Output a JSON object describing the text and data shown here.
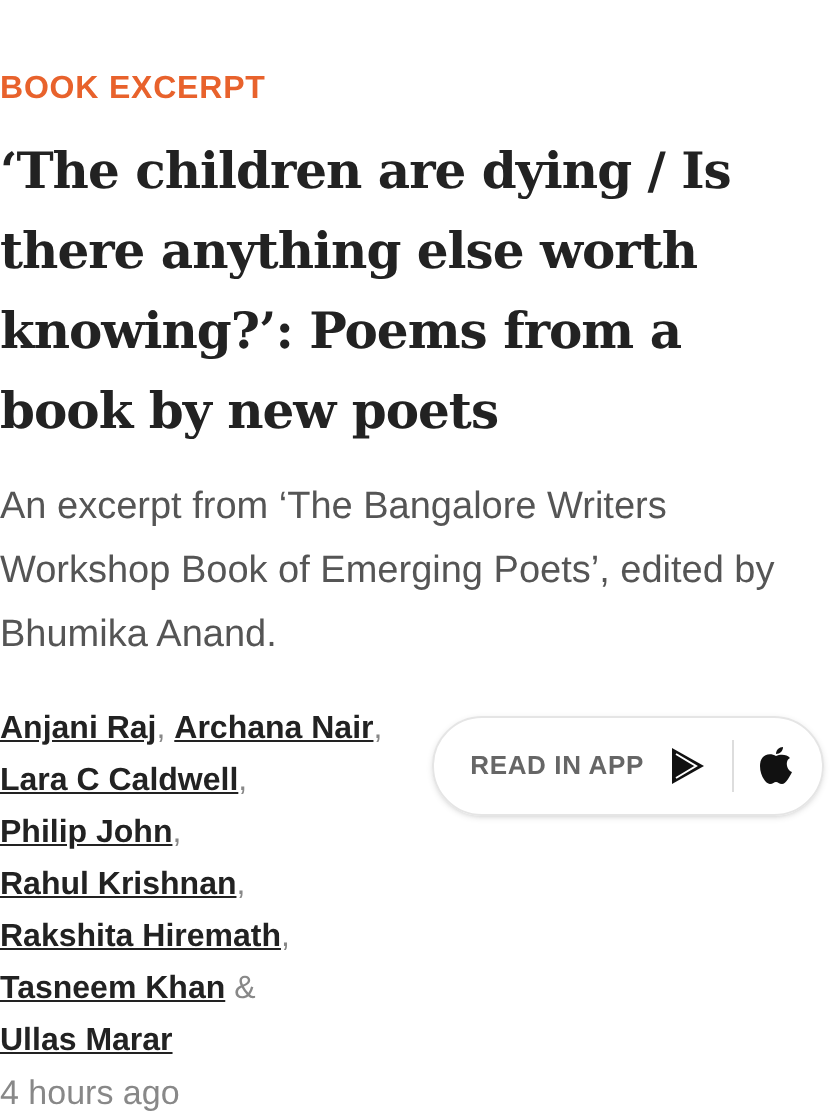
{
  "section_label": "BOOK EXCERPT",
  "headline": "‘The children are dying / Is there anything else worth knowing?’: Poems from a book by new poets",
  "standfirst": "An excerpt from ‘The Bangalore Writers Workshop Book of Emerging Poets’, edited by Bhumika Anand.",
  "authors": [
    {
      "name": "Anjani Raj",
      "separator": ","
    },
    {
      "name": "Archana Nair",
      "separator": ","
    },
    {
      "name": "Lara C Caldwell",
      "separator": ","
    },
    {
      "name": "Philip John",
      "separator": ","
    },
    {
      "name": "Rahul Krishnan",
      "separator": ","
    },
    {
      "name": "Rakshita Hiremath",
      "separator": ","
    },
    {
      "name": "Tasneem Khan",
      "separator": "&"
    },
    {
      "name": "Ullas Marar"
    }
  ],
  "timestamp": "4 hours ago",
  "app_button": {
    "label": "READ IN APP"
  }
}
